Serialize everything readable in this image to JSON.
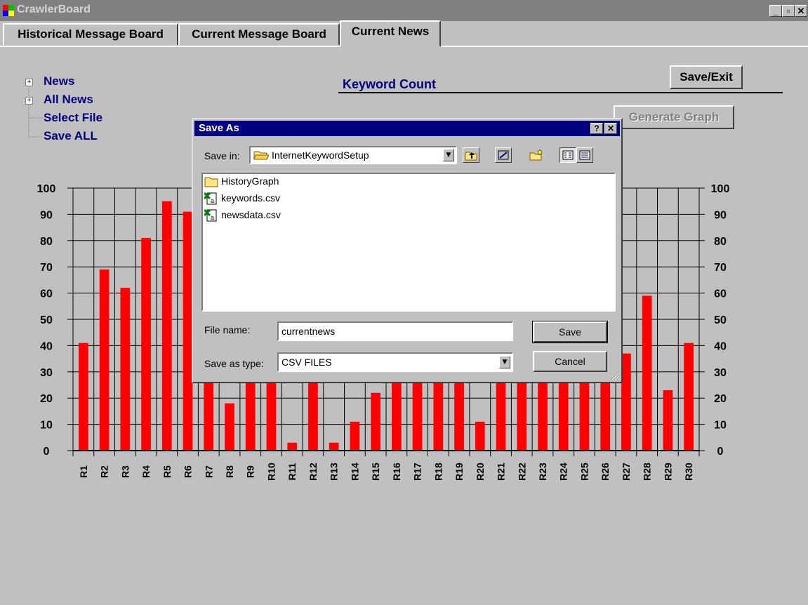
{
  "window": {
    "title": "CrawlerBoard",
    "controls": [
      "_",
      "▫",
      "✕"
    ]
  },
  "tabs": [
    {
      "label": "Historical Message Board",
      "active": false
    },
    {
      "label": "Current Message Board",
      "active": false
    },
    {
      "label": "Current News",
      "active": true
    }
  ],
  "tree": {
    "items": [
      "News",
      "All News",
      "Select File",
      "Save ALL"
    ]
  },
  "chart_heading": "Keyword Count",
  "buttons": {
    "save_exit": "Save/Exit",
    "generate_graph": "Generate Graph"
  },
  "chart_data": {
    "type": "bar",
    "categories": [
      "R1",
      "R2",
      "R3",
      "R4",
      "R5",
      "R6",
      "R7",
      "R8",
      "R9",
      "R10",
      "R11",
      "R12",
      "R13",
      "R14",
      "R15",
      "R16",
      "R17",
      "R18",
      "R19",
      "R20",
      "R21",
      "R22",
      "R23",
      "R24",
      "R25",
      "R26",
      "R27",
      "R28",
      "R29",
      "R30"
    ],
    "values": [
      41,
      69,
      62,
      81,
      95,
      91,
      34,
      18,
      32,
      27,
      3,
      34,
      3,
      11,
      22,
      31,
      30,
      30,
      31,
      11,
      31,
      31,
      31,
      31,
      31,
      30,
      37,
      59,
      23,
      41
    ],
    "ylim": [
      0,
      100
    ],
    "yticks": [
      0,
      10,
      20,
      30,
      40,
      50,
      60,
      70,
      80,
      90,
      100
    ],
    "bar_color": "#ff0000",
    "grid": true,
    "title": "",
    "xlabel": "",
    "ylabel": ""
  },
  "dialog": {
    "title": "Save As",
    "help_btn": "?",
    "close_btn": "✕",
    "save_in_label": "Save in:",
    "save_in_value": "InternetKeywordSetup",
    "files": [
      {
        "name": "HistoryGraph",
        "icon": "folder-icon"
      },
      {
        "name": "keywords.csv",
        "icon": "excel-file-icon"
      },
      {
        "name": "newsdata.csv",
        "icon": "excel-file-icon"
      }
    ],
    "file_name_label": "File name:",
    "file_name_value": "currentnews",
    "save_type_label": "Save as type:",
    "save_type_value": "CSV FILES",
    "save_btn": "Save",
    "cancel_btn": "Cancel"
  }
}
